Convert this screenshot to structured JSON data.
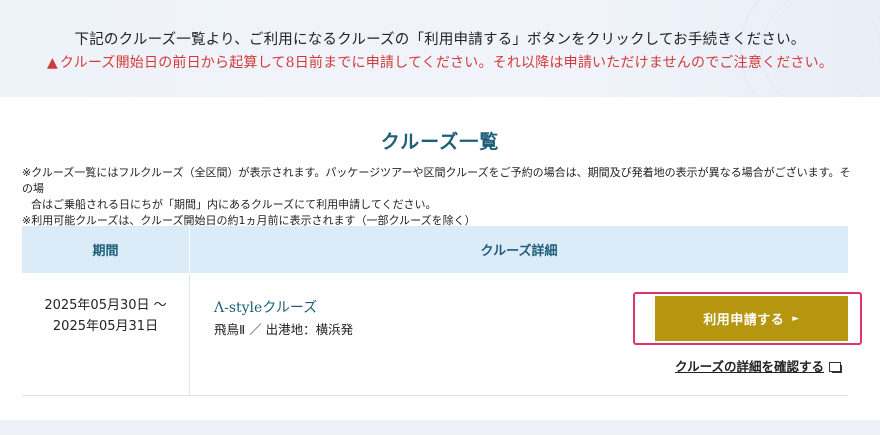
{
  "intro": {
    "line1": "下記のクルーズ一覧より、ご利用になるクルーズの「利用申請する」ボタンをクリックしてお手続きください。",
    "warning_icon": "warning-triangle-icon",
    "line2": "クルーズ開始日の前日から起算して8日前までに申請してください。それ以降は申請いただけませんのでご注意ください。"
  },
  "section": {
    "title": "クルーズ一覧",
    "notes": [
      "※クルーズ一覧にはフルクルーズ（全区間）が表示されます。パッケージツアーや区間クルーズをご予約の場合は、期間及び発着地の表示が異なる場合がございます。その場",
      "合はご乗船される日にちが「期間」内にあるクルーズにて利用申請してください。",
      "※利用可能クルーズは、クルーズ開始日の約1ヵ月前に表示されます（一部クルーズを除く）"
    ]
  },
  "table": {
    "headers": {
      "period": "期間",
      "detail": "クルーズ詳細"
    },
    "rows": [
      {
        "period_start": "2025年05月30日 ～",
        "period_end": "2025年05月31日",
        "cruise_name": "Λ-styleクルーズ",
        "cruise_info": "飛鳥Ⅱ ／ 出港地：横浜発",
        "apply_label": "利用申請する",
        "apply_icon": "play-triangle-icon",
        "detail_link": "クルーズの詳細を確認する",
        "detail_icon": "new-window-icon"
      }
    ]
  },
  "colors": {
    "accent": "#1d5f78",
    "warning": "#d23a3a",
    "button": "#b6960f",
    "highlight": "#e0326c",
    "header_bg": "#dcebf8"
  }
}
